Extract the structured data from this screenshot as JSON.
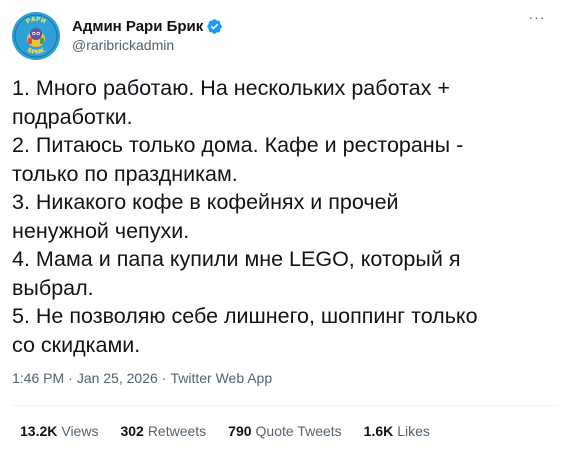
{
  "author": {
    "display_name": "Админ Рари Брик",
    "handle": "@raribrickadmin",
    "verified": true,
    "avatar_text_top": "РАРИ",
    "avatar_text_bottom": "БРИК"
  },
  "tweet": {
    "lines": [
      "1. Много работаю. На нескольких работах +",
      "подработки.",
      "2. Питаюсь только дома. Кафе и рестораны -",
      "только по праздникам.",
      "3. Никакого кофе в кофейнях и прочей",
      "ненужной чепухи.",
      "4. Мама и папа купили мне LEGO, который я",
      "выбрал.",
      "5. Не позволяю себе лишнего, шоппинг только",
      "со скидками."
    ],
    "time": "1:46 PM",
    "date": "Jan 25, 2026",
    "source": "Twitter Web App",
    "separator": "·"
  },
  "more_icon": "···",
  "stats": {
    "views": {
      "num": "13.2K",
      "label": "Views"
    },
    "retweets": {
      "num": "302",
      "label": "Retweets"
    },
    "quotes": {
      "num": "790",
      "label": "Quote Tweets"
    },
    "likes": {
      "num": "1.6K",
      "label": "Likes"
    }
  },
  "colors": {
    "text": "#0f1419",
    "secondary": "#536471",
    "verified": "#1d9bf0",
    "divider": "#eff3f4"
  }
}
